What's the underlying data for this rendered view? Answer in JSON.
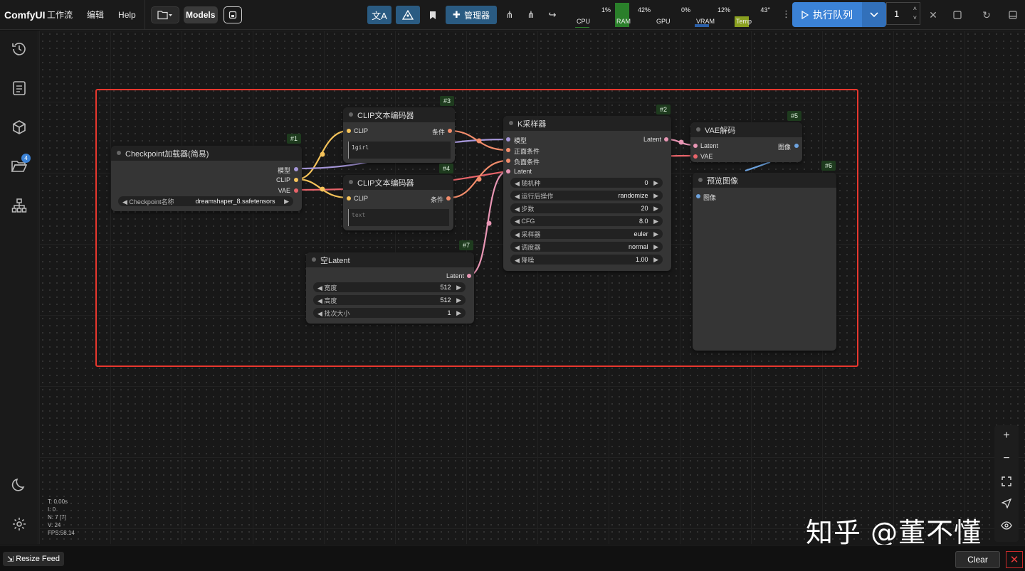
{
  "app": {
    "brand": "ComfyUI"
  },
  "menu": {
    "workflow": "工作流",
    "edit": "编辑",
    "help": "Help"
  },
  "toolbar": {
    "models": "Models",
    "manager": "管理器",
    "run": "执行队列",
    "queue_count": "1"
  },
  "monitors": [
    {
      "label": "CPU",
      "value": "1%",
      "fill": 0.01,
      "color": "#2a7f2a"
    },
    {
      "label": "RAM",
      "value": "42%",
      "fill": 1.0,
      "color": "#2a7f2a"
    },
    {
      "label": "GPU",
      "value": "0%",
      "fill": 0.0,
      "color": "#2a7f2a"
    },
    {
      "label": "VRAM",
      "value": "12%",
      "fill": 0.12,
      "color": "#2a5fa8"
    },
    {
      "label": "Temp",
      "value": "43°",
      "fill": 0.43,
      "color": "#8aa020"
    }
  ],
  "sidebar": {
    "queue_badge": "4"
  },
  "nodes": {
    "checkpoint": {
      "id": "#1",
      "title": "Checkpoint加载器(简易)",
      "outputs": [
        "模型",
        "CLIP",
        "VAE"
      ],
      "widget_label": "Checkpoint名称",
      "widget_value": "dreamshaper_8.safetensors"
    },
    "clip_pos": {
      "id": "#3",
      "title": "CLIP文本编码器",
      "input": "CLIP",
      "output": "条件",
      "text": "1girl"
    },
    "clip_neg": {
      "id": "#4",
      "title": "CLIP文本编码器",
      "input": "CLIP",
      "output": "条件",
      "placeholder": "text"
    },
    "latent": {
      "id": "#7",
      "title": "空Latent",
      "output": "Latent",
      "widgets": [
        {
          "label": "宽度",
          "value": "512"
        },
        {
          "label": "高度",
          "value": "512"
        },
        {
          "label": "批次大小",
          "value": "1"
        }
      ]
    },
    "ksampler": {
      "id": "#2",
      "title": "K采样器",
      "output": "Latent",
      "inputs": [
        "模型",
        "正面条件",
        "负面条件",
        "Latent"
      ],
      "widgets": [
        {
          "label": "随机种",
          "value": "0"
        },
        {
          "label": "运行后操作",
          "value": "randomize"
        },
        {
          "label": "步数",
          "value": "20"
        },
        {
          "label": "CFG",
          "value": "8.0"
        },
        {
          "label": "采样器",
          "value": "euler"
        },
        {
          "label": "调度器",
          "value": "normal"
        },
        {
          "label": "降噪",
          "value": "1.00"
        }
      ]
    },
    "vae_decode": {
      "id": "#5",
      "title": "VAE解码",
      "inputs": [
        "Latent",
        "VAE"
      ],
      "output": "图像"
    },
    "preview": {
      "id": "#6",
      "title": "预览图像",
      "input": "图像"
    }
  },
  "stats": [
    "T: 0.00s",
    "I: 0",
    "N: 7 [7]",
    "V: 24",
    "FPS:58.14"
  ],
  "watermark": "知乎 @董不懂",
  "bottom": {
    "resize": "Resize Feed",
    "clear": "Clear"
  },
  "colors": {
    "accent": "#3b82d6",
    "frame": "#e8372e",
    "clip": "#f5c35a",
    "model": "#a596d8",
    "vae": "#e8646a",
    "cond": "#f28c6b",
    "latent": "#e896b4",
    "image": "#6ea4e0"
  }
}
